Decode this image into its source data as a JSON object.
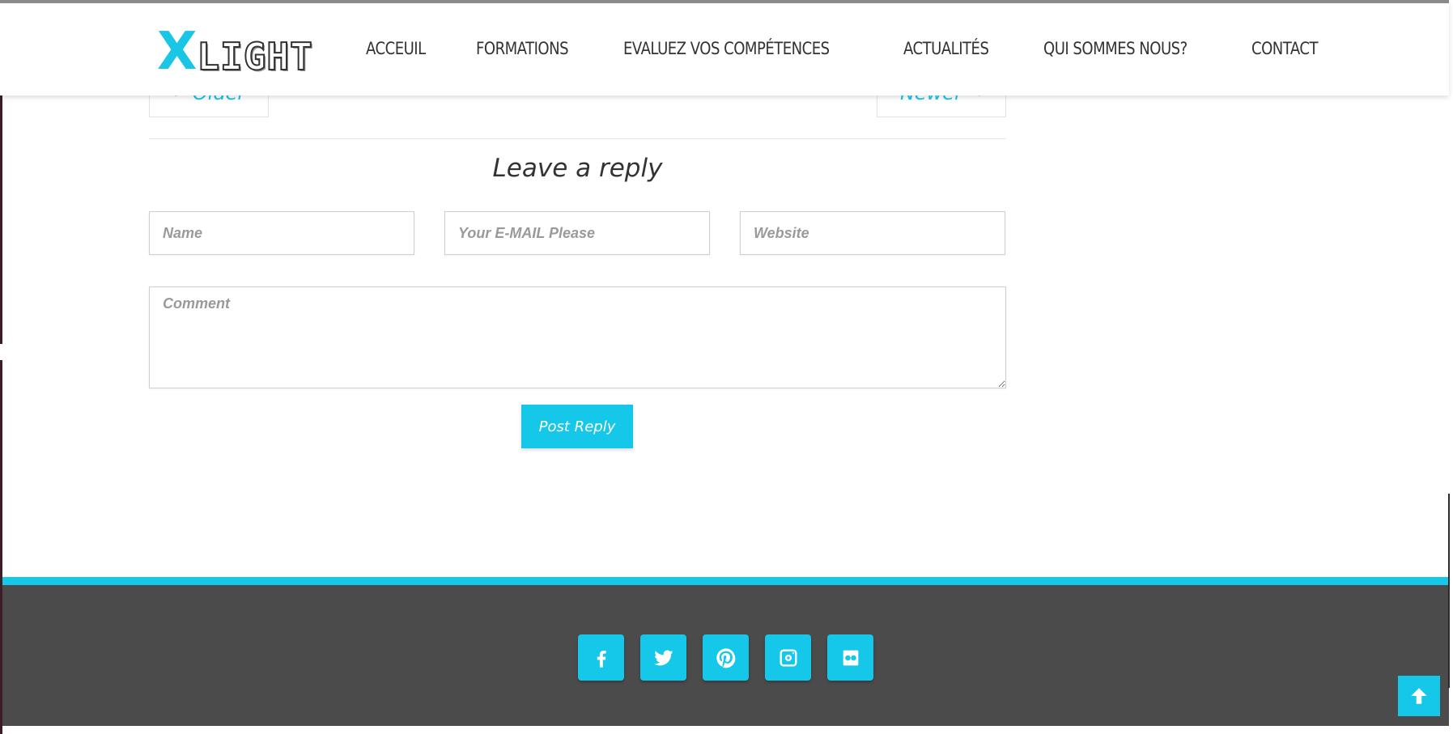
{
  "header": {
    "logo": {
      "x": "X",
      "rest": "LIGHT"
    },
    "nav": [
      "ACCEUIL",
      "FORMATIONS",
      "EVALUEZ VOS COMPÉTENCES",
      "ACTUALITÉS",
      "QUI SOMMES NOUS?",
      "CONTACT"
    ]
  },
  "pager": {
    "older": "Older",
    "newer": "Newer"
  },
  "reply": {
    "title": "Leave a reply",
    "name_placeholder": "Name",
    "email_placeholder": "Your E-MAIL Please",
    "website_placeholder": "Website",
    "comment_placeholder": "Comment",
    "submit_label": "Post Reply"
  },
  "footer": {
    "social": [
      "facebook-icon",
      "twitter-icon",
      "pinterest-icon",
      "instagram-icon",
      "flickr-icon"
    ]
  },
  "colors": {
    "accent": "#15c7e8",
    "footer_bg": "#4b4b4c",
    "text": "#333333"
  }
}
